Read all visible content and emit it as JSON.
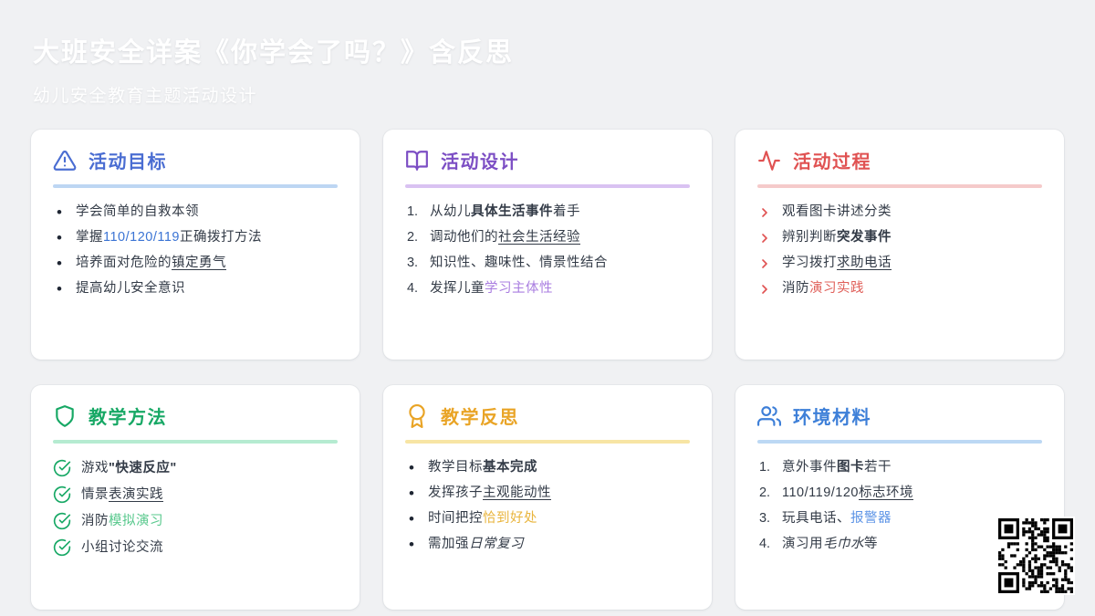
{
  "page": {
    "background_color": "#f0f1f3"
  },
  "header": {
    "title": "大班安全详案《你学会了吗？》含反思",
    "subtitle": "幼儿安全教育主题活动设计"
  },
  "cards": [
    {
      "id": "activity-goals",
      "title": "活动目标",
      "icon": "alert-triangle-icon",
      "accent": "#4a6dd2",
      "underline_color": "#bdd6f3",
      "marker": "bullet",
      "items": [
        {
          "segments": [
            {
              "text": "学会简单的自救本领",
              "style": "plain"
            }
          ]
        },
        {
          "segments": [
            {
              "text": "掌握",
              "style": "plain"
            },
            {
              "text": "110/120/119",
              "style": "color",
              "color": "#3b74d4"
            },
            {
              "text": "正确拨打方法",
              "style": "plain"
            }
          ]
        },
        {
          "segments": [
            {
              "text": "培养面对危险的",
              "style": "plain"
            },
            {
              "text": "镇定勇气",
              "style": "underline"
            }
          ]
        },
        {
          "segments": [
            {
              "text": "提高幼儿安全意识",
              "style": "plain"
            }
          ]
        }
      ]
    },
    {
      "id": "activity-design",
      "title": "活动设计",
      "icon": "book-open-icon",
      "accent": "#7c4ec4",
      "underline_color": "#d9c2f2",
      "marker": "number",
      "items": [
        {
          "segments": [
            {
              "text": "从幼儿",
              "style": "plain"
            },
            {
              "text": "具体生活事件",
              "style": "bold"
            },
            {
              "text": "着手",
              "style": "plain"
            }
          ]
        },
        {
          "segments": [
            {
              "text": "调动他们的",
              "style": "plain"
            },
            {
              "text": "社会生活经验",
              "style": "underline"
            }
          ]
        },
        {
          "segments": [
            {
              "text": "知识性、趣味性、情景性结合",
              "style": "plain"
            }
          ]
        },
        {
          "segments": [
            {
              "text": "发挥儿童",
              "style": "plain"
            },
            {
              "text": "学习主体性",
              "style": "color",
              "color": "#a97de0"
            }
          ]
        }
      ]
    },
    {
      "id": "activity-process",
      "title": "活动过程",
      "icon": "activity-icon",
      "accent": "#e05252",
      "underline_color": "#f5caca",
      "marker": "chevron",
      "items": [
        {
          "segments": [
            {
              "text": "观看图卡讲述分类",
              "style": "plain"
            }
          ]
        },
        {
          "segments": [
            {
              "text": "辨别判断",
              "style": "plain"
            },
            {
              "text": "突发事件",
              "style": "bold"
            }
          ]
        },
        {
          "segments": [
            {
              "text": "学习拨打",
              "style": "plain"
            },
            {
              "text": "求助电话",
              "style": "underline"
            }
          ]
        },
        {
          "segments": [
            {
              "text": "消防",
              "style": "plain"
            },
            {
              "text": "演习实践",
              "style": "color",
              "color": "#e0605a"
            }
          ]
        }
      ]
    },
    {
      "id": "teaching-methods",
      "title": "教学方法",
      "icon": "shield-icon",
      "accent": "#17a865",
      "underline_color": "#b5ebd1",
      "marker": "check",
      "items": [
        {
          "segments": [
            {
              "text": "游戏",
              "style": "plain"
            },
            {
              "text": "\"快速反应\"",
              "style": "bold"
            }
          ]
        },
        {
          "segments": [
            {
              "text": "情景",
              "style": "plain"
            },
            {
              "text": "表演实践",
              "style": "underline"
            }
          ]
        },
        {
          "segments": [
            {
              "text": "消防",
              "style": "plain"
            },
            {
              "text": "模拟演习",
              "style": "color",
              "color": "#57c88c"
            }
          ]
        },
        {
          "segments": [
            {
              "text": "小组讨论交流",
              "style": "plain"
            }
          ]
        }
      ]
    },
    {
      "id": "teaching-reflection",
      "title": "教学反思",
      "icon": "award-icon",
      "accent": "#e9a426",
      "underline_color": "#f7e5a4",
      "marker": "bullet",
      "items": [
        {
          "segments": [
            {
              "text": "教学目标",
              "style": "plain"
            },
            {
              "text": "基本完成",
              "style": "bold"
            }
          ]
        },
        {
          "segments": [
            {
              "text": "发挥孩子",
              "style": "plain"
            },
            {
              "text": "主观能动性",
              "style": "underline"
            }
          ]
        },
        {
          "segments": [
            {
              "text": "时间把控",
              "style": "plain"
            },
            {
              "text": "恰到好处",
              "style": "color",
              "color": "#e9b53e"
            }
          ]
        },
        {
          "segments": [
            {
              "text": "需加强",
              "style": "plain"
            },
            {
              "text": "日常复习",
              "style": "italic"
            }
          ]
        }
      ]
    },
    {
      "id": "environment-materials",
      "title": "环境材料",
      "icon": "users-icon",
      "accent": "#3d7fd8",
      "underline_color": "#bcd8f4",
      "marker": "number",
      "items": [
        {
          "segments": [
            {
              "text": "意外事件",
              "style": "plain"
            },
            {
              "text": "图卡",
              "style": "bold"
            },
            {
              "text": "若干",
              "style": "plain"
            }
          ]
        },
        {
          "segments": [
            {
              "text": "110/119/120",
              "style": "plain"
            },
            {
              "text": "标志环境",
              "style": "underline"
            }
          ]
        },
        {
          "segments": [
            {
              "text": "玩具电话、",
              "style": "plain"
            },
            {
              "text": "报警器",
              "style": "color",
              "color": "#5d94e6"
            }
          ]
        },
        {
          "segments": [
            {
              "text": "演习用",
              "style": "plain"
            },
            {
              "text": "毛巾水",
              "style": "italic"
            },
            {
              "text": "等",
              "style": "plain"
            }
          ]
        }
      ]
    }
  ],
  "qr_code": {
    "foreground": "#000000",
    "background": "#ffffff"
  }
}
